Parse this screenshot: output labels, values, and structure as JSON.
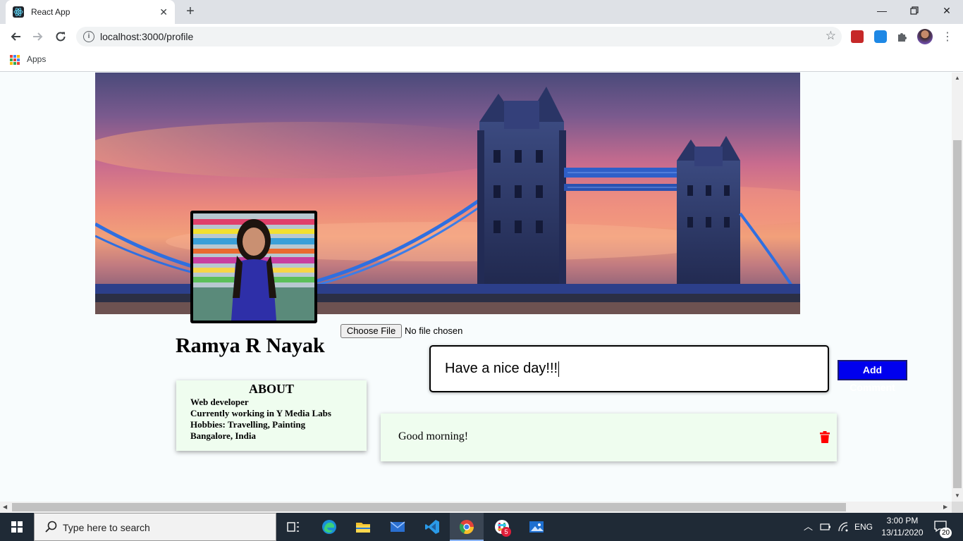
{
  "browser": {
    "tab_title": "React App",
    "url": "localhost:3000/profile",
    "bookmarks_apps_label": "Apps"
  },
  "profile": {
    "file_button_label": "Choose File",
    "file_status": "No file chosen",
    "name": "Ramya R Nayak",
    "about": {
      "heading": "ABOUT",
      "lines": [
        "Web developer",
        "Currently working in Y Media Labs",
        "Hobbies: Travelling, Painting",
        "Bangalore, India"
      ]
    }
  },
  "comments": {
    "input_value": "Have a nice day!!!",
    "add_button_label": "Add Comment",
    "items": [
      {
        "text": "Good morning!"
      }
    ]
  },
  "taskbar": {
    "search_placeholder": "Type here to search",
    "language": "ENG",
    "time": "3:00 PM",
    "date": "13/11/2020",
    "notification_count": "20",
    "slack_badge": "5"
  },
  "colors": {
    "add_button_bg": "#0000ee",
    "card_bg": "#effdef",
    "delete_icon": "#ff0000",
    "taskbar_bg": "#1f2a36"
  }
}
